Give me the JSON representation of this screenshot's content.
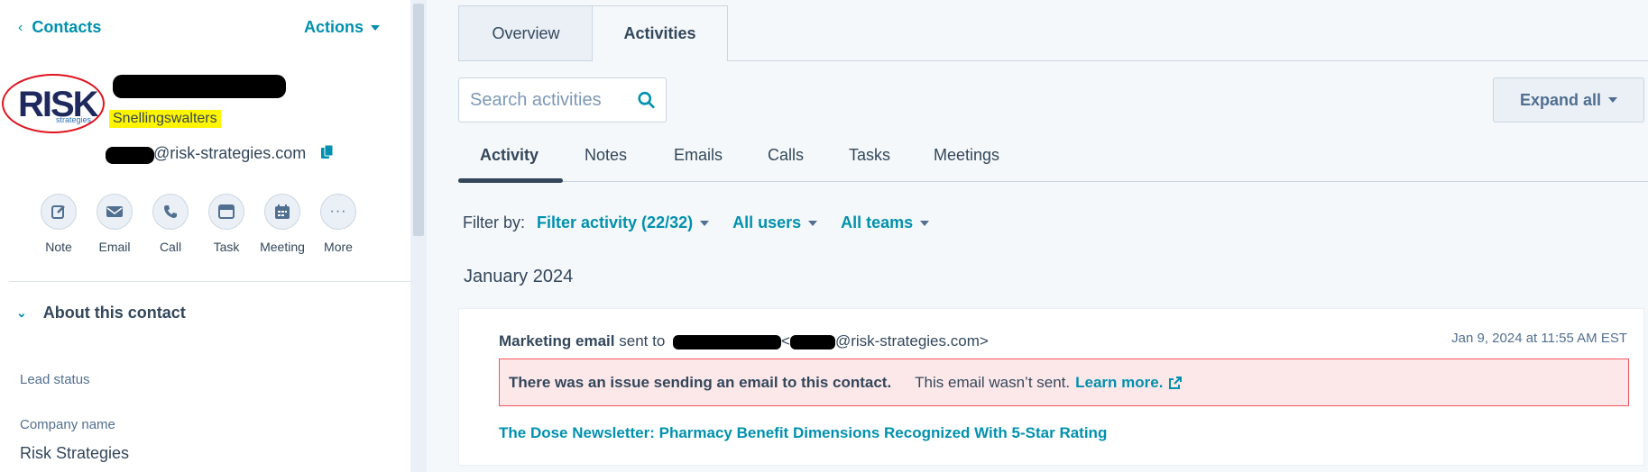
{
  "sidebar": {
    "back_label": "Contacts",
    "actions_label": "Actions",
    "logo": {
      "text": "RISK",
      "sub": "strategies"
    },
    "contact_name_highlight": "Snellingswalters",
    "email_suffix": "@risk-strategies.com",
    "quick_actions": [
      {
        "label": "Note",
        "icon": "note-icon"
      },
      {
        "label": "Email",
        "icon": "email-icon"
      },
      {
        "label": "Call",
        "icon": "call-icon"
      },
      {
        "label": "Task",
        "icon": "task-icon"
      },
      {
        "label": "Meeting",
        "icon": "meeting-icon"
      },
      {
        "label": "More",
        "icon": "more-icon"
      }
    ],
    "about_title": "About this contact",
    "properties": [
      {
        "label": "Lead status",
        "value": ""
      },
      {
        "label": "Company name",
        "value": "Risk Strategies"
      }
    ]
  },
  "main": {
    "tabs": [
      {
        "label": "Overview"
      },
      {
        "label": "Activities"
      }
    ],
    "search_placeholder": "Search activities",
    "expand_label": "Expand all",
    "subtabs": [
      {
        "label": "Activity"
      },
      {
        "label": "Notes"
      },
      {
        "label": "Emails"
      },
      {
        "label": "Calls"
      },
      {
        "label": "Tasks"
      },
      {
        "label": "Meetings"
      }
    ],
    "filter": {
      "label": "Filter by:",
      "activity": "Filter activity (22/32)",
      "users": "All users",
      "teams": "All teams"
    },
    "month_heading": "January 2024",
    "card": {
      "type": "Marketing email",
      "sent_to": "sent to",
      "recipient_suffix": "@risk-strategies.com>",
      "date": "Jan 9, 2024 at 11:55 AM EST",
      "alert_strong": "There was an issue sending an email to this contact.",
      "alert_normal": "This email wasn’t sent.",
      "alert_link": "Learn more.",
      "email_subject": "The Dose Newsletter: Pharmacy Benefit Dimensions Recognized With 5-Star Rating"
    }
  },
  "colors": {
    "accent": "#0091ae",
    "text": "#33475b",
    "alert_bg": "#fde8e9",
    "alert_border": "#f2545b",
    "highlight": "#fff500"
  }
}
